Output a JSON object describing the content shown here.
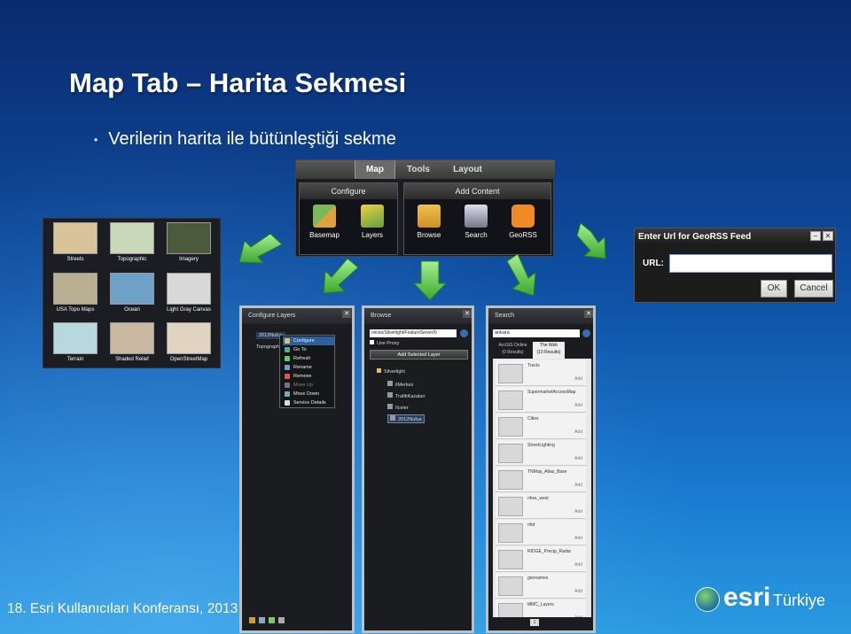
{
  "slide": {
    "title": "Map Tab – Harita Sekmesi",
    "bullet": "Verilerin harita ile bütünleştiği sekme",
    "footer": "18. Esri Kullanıcıları Konferansı, 2013",
    "logo_brand": "esri",
    "logo_country": "Türkiye"
  },
  "ribbon": {
    "tabs": [
      "Map",
      "Tools",
      "Layout"
    ],
    "groups": {
      "configure": {
        "title": "Configure",
        "buttons": [
          "Basemap",
          "Layers"
        ]
      },
      "add_content": {
        "title": "Add Content",
        "buttons": [
          "Browse",
          "Search",
          "GeoRSS"
        ]
      }
    }
  },
  "basemaps": [
    {
      "label": "Streets",
      "color": "#d9c39a"
    },
    {
      "label": "Topographic",
      "color": "#c8d8b8"
    },
    {
      "label": "Imagery",
      "color": "#4a5a3a"
    },
    {
      "label": "USA Topo Maps",
      "color": "#b8b090"
    },
    {
      "label": "Ocean",
      "color": "#6fa0c8"
    },
    {
      "label": "Light Gray Canvas",
      "color": "#d8d8d8"
    },
    {
      "label": "Terrain",
      "color": "#b8d8e0"
    },
    {
      "label": "Shaded Relief",
      "color": "#c8b8a0"
    },
    {
      "label": "OpenStreetMap",
      "color": "#e0d4c0"
    }
  ],
  "georss_dialog": {
    "title": "Enter Url for GeoRSS Feed",
    "url_label": "URL:",
    "url_value": "",
    "ok": "OK",
    "cancel": "Cancel"
  },
  "configure_panel": {
    "title": "Configure Layers",
    "layer_1": "2012Nufus",
    "layer_2": "Topograph",
    "menu": [
      "Configure",
      "Go To",
      "Refresh",
      "Rename",
      "Remove",
      "Move Up",
      "Move Down",
      "Service Details"
    ]
  },
  "browse_panel": {
    "title": "Browse",
    "url": "rvices/Silverlight/FeatureServer/0",
    "use_proxy": "Use Proxy",
    "add_button": "Add Selected Layer",
    "tree_root": "Silverlight",
    "layers": [
      "ilMerkez",
      "TrafikKazalari",
      "Ilceler",
      "2012Nufus"
    ]
  },
  "search_panel": {
    "title": "Search",
    "query": "ankara",
    "tab_online": "ArcGIS Online",
    "tab_online_count": "(0 Results)",
    "tab_web": "The Web",
    "tab_web_count": "(10 Results)",
    "add_label": "Add",
    "results": [
      "Tracts",
      "SupermarketAccessMap",
      "Cities",
      "StreetLighting",
      "TNMap_Atlas_Base",
      "nhss_west",
      "nhd",
      "RIDGE_Precip_Radar",
      "geonames",
      "MMC_Layers"
    ],
    "page": "1"
  },
  "colors": {
    "accent_green": "#5cc04a",
    "panel_bg": "#1a1c20"
  }
}
